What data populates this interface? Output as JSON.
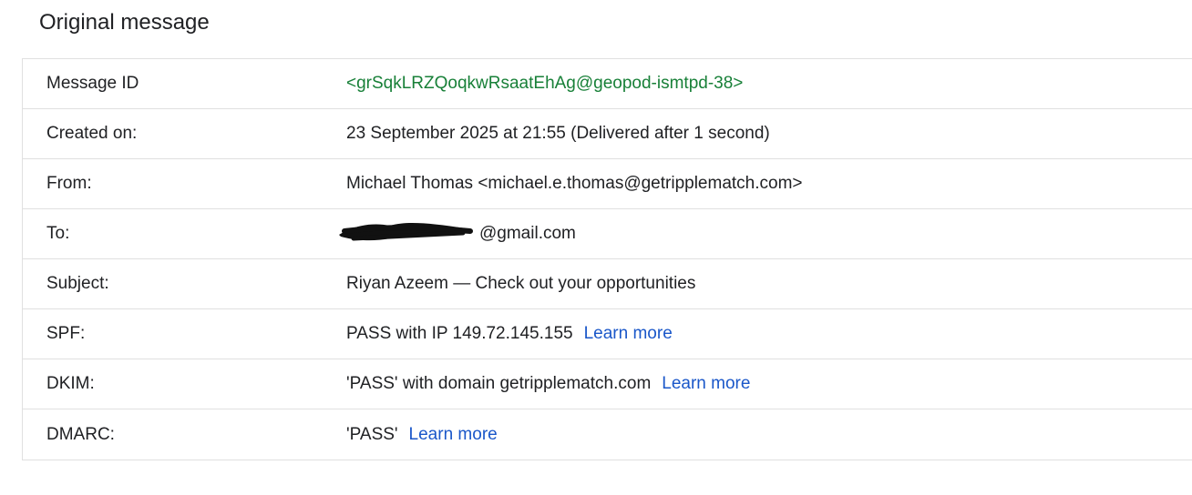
{
  "page": {
    "title": "Original message"
  },
  "rows": [
    {
      "label": "Message ID",
      "value": "<grSqkLRZQoqkwRsaatEhAg@geopod-ismtpd-38>"
    },
    {
      "label": "Created on:",
      "value": "23 September 2025 at 21:55 (Delivered after 1 second)"
    },
    {
      "label": "From:",
      "value": "Michael Thomas <michael.e.thomas@getripplematch.com>"
    },
    {
      "label": "To:",
      "value": "@gmail.com",
      "redacted": true
    },
    {
      "label": "Subject:",
      "value": "Riyan Azeem — Check out your opportunities"
    },
    {
      "label": "SPF:",
      "value": "PASS with IP 149.72.145.155",
      "link": "Learn more"
    },
    {
      "label": "DKIM:",
      "value": "'PASS' with domain getripplematch.com",
      "link": "Learn more"
    },
    {
      "label": "DMARC:",
      "value": "'PASS'",
      "link": "Learn more"
    }
  ],
  "colors": {
    "message_id": "#188038",
    "link": "#1a57c9",
    "border": "#e0e0e0",
    "text": "#202124",
    "redaction": "#111111"
  }
}
